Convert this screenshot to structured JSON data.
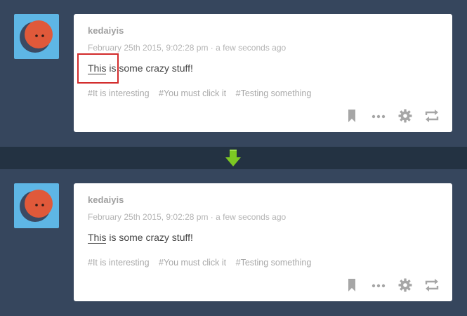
{
  "colors": {
    "background": "#36465d",
    "divider": "#233242",
    "avatar_bg": "#5eb6e5",
    "avatar_face": "#e0593a",
    "highlight_border": "#d22b2b",
    "arrow": "#7cc823",
    "icon_gray": "#a6a6a6"
  },
  "posts": [
    {
      "username": "kedaiyis",
      "timestamp": "February 25th 2015, 9:02:28 pm · a few seconds ago",
      "body_link": "This",
      "body_rest": " is some crazy stuff!",
      "highlighted": true,
      "tags": [
        "#It is interesting",
        "#You must click it",
        "#Testing something"
      ]
    },
    {
      "username": "kedaiyis",
      "timestamp": "February 25th 2015, 9:02:28 pm · a few seconds ago",
      "body_link": "This",
      "body_rest": " is some crazy stuff!",
      "highlighted": false,
      "tags": [
        "#It is interesting",
        "#You must click it",
        "#Testing something"
      ]
    }
  ],
  "icons": {
    "divider": "down-arrow-icon",
    "actions": [
      "bookmark-icon",
      "more-dots-icon",
      "gear-icon",
      "reblog-icon"
    ]
  }
}
